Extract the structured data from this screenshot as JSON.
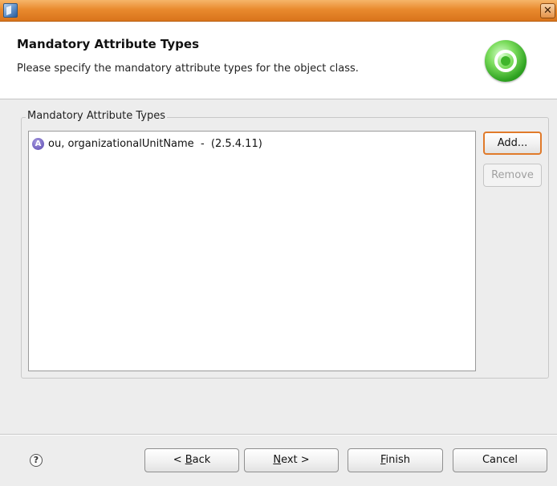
{
  "titlebar": {
    "close_label": "✕"
  },
  "header": {
    "title": "Mandatory Attribute Types",
    "description": "Please specify the mandatory attribute types for the object class."
  },
  "group": {
    "label": "Mandatory Attribute Types",
    "items": [
      {
        "icon_letter": "A",
        "text": "ou, organizationalUnitName  -  (2.5.4.11)"
      }
    ],
    "add_label": "Add...",
    "remove_label": "Remove"
  },
  "footer": {
    "help_label": "?",
    "back": {
      "pre": "< ",
      "mnemonic": "B",
      "post": "ack"
    },
    "next": {
      "pre": "",
      "mnemonic": "N",
      "post": "ext >"
    },
    "finish": {
      "pre": "",
      "mnemonic": "F",
      "post": "inish"
    },
    "cancel_label": "Cancel"
  },
  "colors": {
    "titlebar": "#e98a2e",
    "default_button_border": "#e07a2a",
    "attribute_icon": "#6a58c0",
    "wizard_icon": "#2ea221"
  }
}
